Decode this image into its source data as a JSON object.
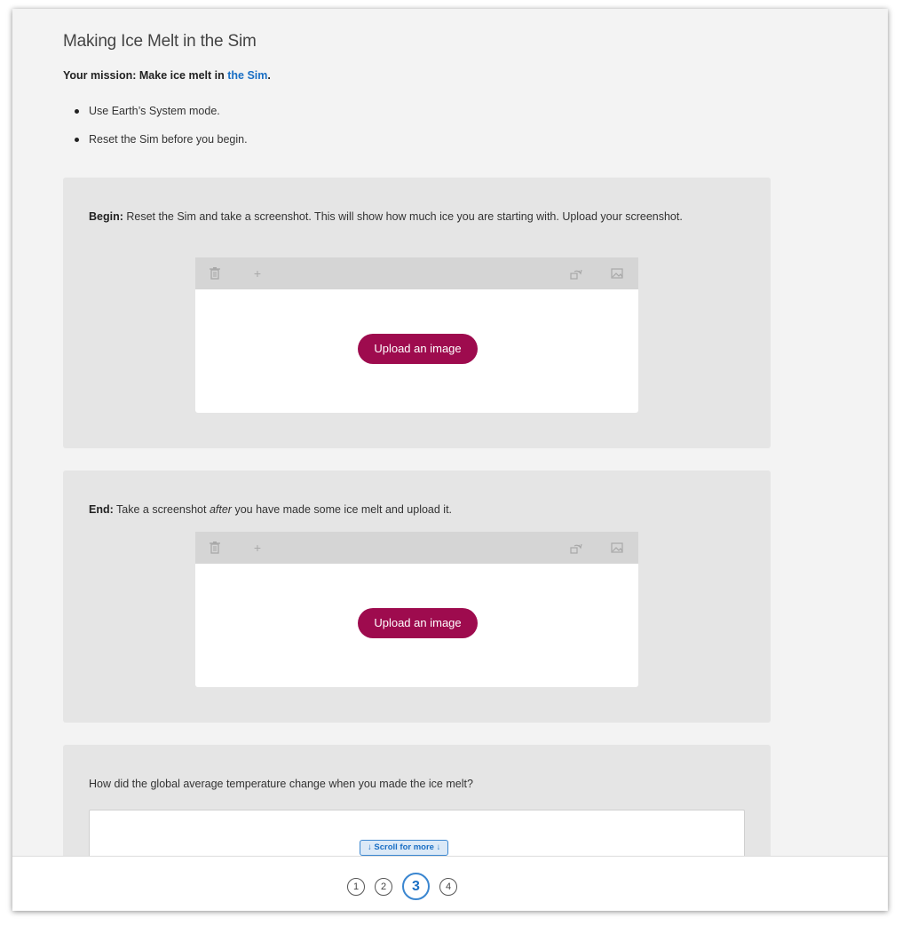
{
  "header": {
    "title": "Making Ice Melt in the Sim",
    "mission_prefix": "Your mission: Make ice melt in ",
    "mission_link": "the Sim",
    "mission_suffix": "."
  },
  "instructions": [
    "Use Earth’s System mode.",
    "Reset the Sim before you begin."
  ],
  "cards": {
    "begin": {
      "label": "Begin:",
      "text": " Reset the Sim and take a screenshot. This will show how much ice you are starting with. Upload your screenshot.",
      "upload_label": "Upload an image"
    },
    "end": {
      "label": "End:",
      "text_before": " Take a screenshot ",
      "text_em": "after",
      "text_after": " you have made some ice melt and upload it.",
      "upload_label": "Upload an image"
    },
    "question": {
      "text": "How did the global average temperature change when you made the ice melt?"
    }
  },
  "toolbar_icons": [
    "trash-icon",
    "plus-icon",
    "rotate-icon",
    "image-icon"
  ],
  "scroll_hint": "↓ Scroll for more ↓",
  "pager": {
    "pages": [
      "1",
      "2",
      "3",
      "4"
    ],
    "current": "3"
  },
  "colors": {
    "accent": "#9e0b4e",
    "link": "#1a6fc4",
    "card_bg": "#e5e5e5",
    "page_bg": "#f3f3f3"
  }
}
